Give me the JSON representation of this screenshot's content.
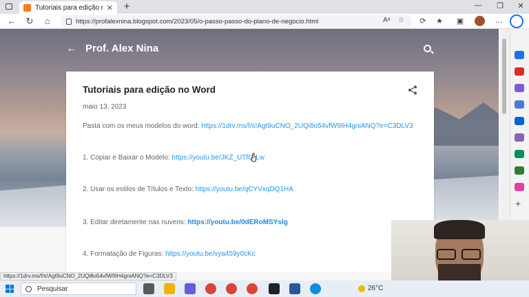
{
  "browser": {
    "tab_title": "Tutoriais para edição no Word",
    "tab_close": "✕",
    "new_tab": "+",
    "url": "https://profalexnina.blogspot.com/2023/05/o-passo-passo-do-plano-de-negocio.html",
    "window_controls": [
      "—",
      "❐",
      "✕"
    ],
    "nav_icons": [
      "arrow-left-icon",
      "refresh-icon",
      "home-icon"
    ]
  },
  "blog": {
    "back_glyph": "←",
    "title": "Prof. Alex Nina"
  },
  "post": {
    "title": "Tutoriais para edição no Word",
    "date": "maio 13, 2023",
    "paragraphs": [
      {
        "text": "Pasta com os meus modelos do word: ",
        "link": "https://1drv.ms/f/s!Agt9uCNO_2UQi8o54vfW9IH4gniANQ?e=C3DLV3",
        "bold": false
      },
      {
        "text": "1. Copiar e Baixar o Modelo: ",
        "link": "https://youtu.be/JKZ_UTfQ-Lw",
        "bold": false
      },
      {
        "text": "2. Usar os estilos de Títulos e Texto: ",
        "link": "https://youtu.be/qCYVxqDQ1HA",
        "bold": false
      },
      {
        "text": "3. Editar diretamente nas nuvens: ",
        "link": "https://youtu.be/0dERoMSYslg",
        "bold": true
      },
      {
        "text": "4. Formatação de Figuras: ",
        "link": "https://youtu.be/vya459y0cKc",
        "bold": false
      }
    ]
  },
  "status_link": "https://1drv.ms/f/s!Agt9uCNO_2UQi8o54vfW9IH4gniANQ?e=C3DLV3",
  "taskbar": {
    "search_label": "Pesquisar",
    "temperature": "26°C"
  },
  "colors": {
    "link": "#2196f3",
    "windows_blue": "#0078d4",
    "blogger_orange": "#f4801f"
  }
}
